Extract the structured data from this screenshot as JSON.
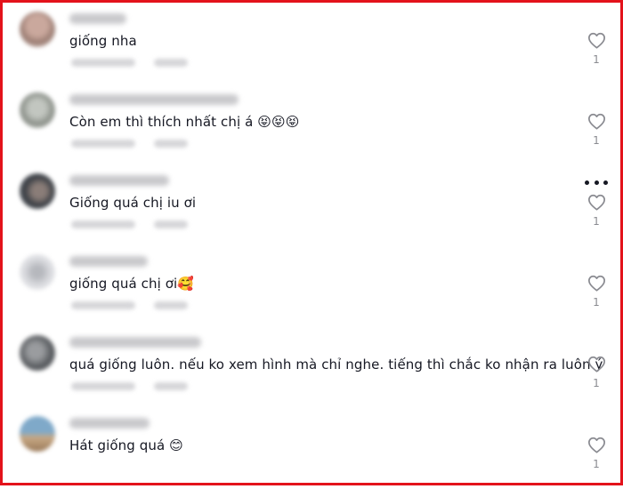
{
  "comments": [
    {
      "text": "giống nha",
      "emojis": "",
      "likes": "1",
      "avatar_color": "#b9a39a",
      "avatar_accent": "#7e5f55"
    },
    {
      "text": "Còn em thì thích nhất chị á ",
      "emojis": "😝😝😝",
      "likes": "1",
      "avatar_color": "#aeb3ad",
      "avatar_accent": "#7b8077"
    },
    {
      "text": "Giống quá chị iu ơi",
      "emojis": "",
      "likes": "1",
      "avatar_color": "#3b3f45",
      "avatar_accent": "#8a7d78"
    },
    {
      "text": "giống quá chị ơi",
      "emojis": "🥰",
      "likes": "1",
      "avatar_color": "#d9dade",
      "avatar_accent": "#b0b2b8"
    },
    {
      "text": "quá giống luôn. nếu ko xem hình mà chỉ nghe. tiếng thì chắc ko nhận ra luôn ý",
      "emojis": "",
      "likes": "1",
      "avatar_color": "#55585c",
      "avatar_accent": "#9a9c9f"
    },
    {
      "text": "Hát giống quá ",
      "emojis": "😊",
      "likes": "1",
      "avatar_color": "#7fa9c9",
      "avatar_accent": "#c7a884"
    }
  ],
  "colors": {
    "border": "#e3121b",
    "text": "#161823",
    "count": "#8a8b91",
    "heart": "#8a8b91"
  },
  "icons": {
    "like": "heart-outline-icon",
    "more": "more-dots-icon"
  }
}
